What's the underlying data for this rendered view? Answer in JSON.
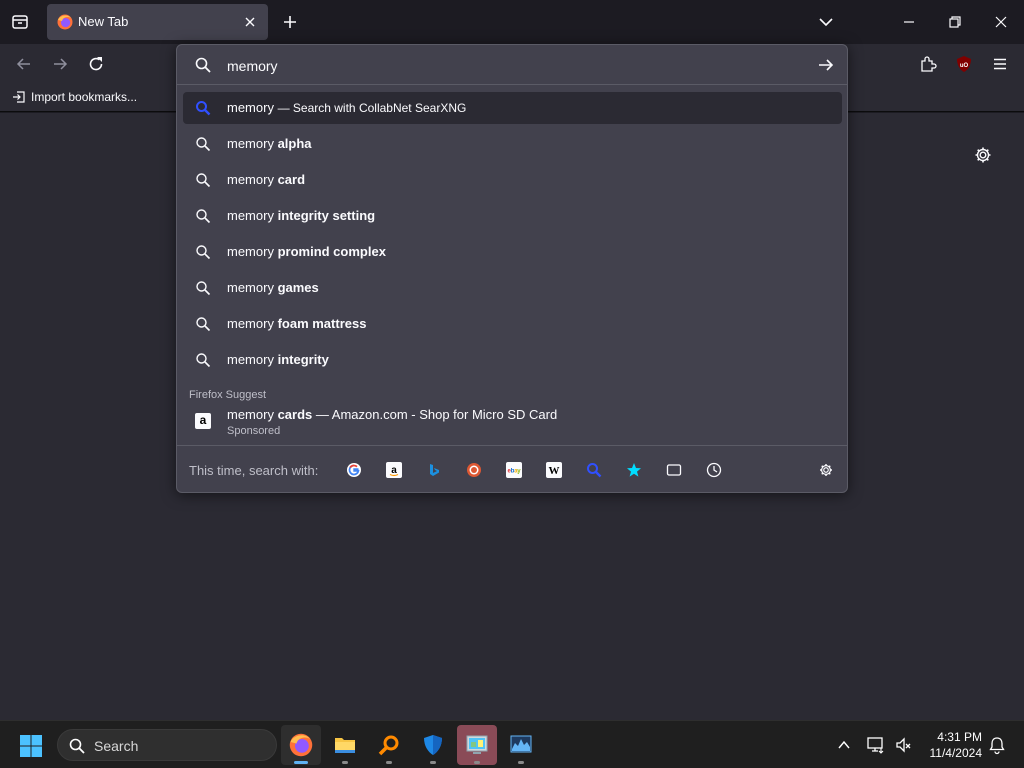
{
  "browser": {
    "tab_title": "New Tab",
    "bookmarks": {
      "import_label": "Import bookmarks..."
    }
  },
  "urlbar": {
    "value": "memory",
    "results": [
      {
        "prefix": "memory",
        "bold": "",
        "suffix": "— Search with CollabNet SearXNG",
        "selected": true
      },
      {
        "prefix": "memory",
        "bold": "alpha"
      },
      {
        "prefix": "memory",
        "bold": "card"
      },
      {
        "prefix": "memory",
        "bold": "integrity setting"
      },
      {
        "prefix": "memory",
        "bold": "promind complex"
      },
      {
        "prefix": "memory",
        "bold": "games"
      },
      {
        "prefix": "memory",
        "bold": "foam mattress"
      },
      {
        "prefix": "memory",
        "bold": "integrity"
      }
    ],
    "suggest_label": "Firefox Suggest",
    "sponsored": {
      "prefix": "memory",
      "bold": "cards",
      "rest": "— Amazon.com - Shop for Micro SD Card",
      "sub": "Sponsored",
      "icon_letter": "a"
    },
    "oneoff_label": "This time, search with:"
  },
  "taskbar": {
    "search_label": "Search",
    "time": "4:31 PM",
    "date": "11/4/2024"
  },
  "colors": {
    "accent": "#5fb2f2",
    "searxng_blue": "#3050ff",
    "popup_bg": "#42414d",
    "page_bg": "#2b2a33"
  }
}
